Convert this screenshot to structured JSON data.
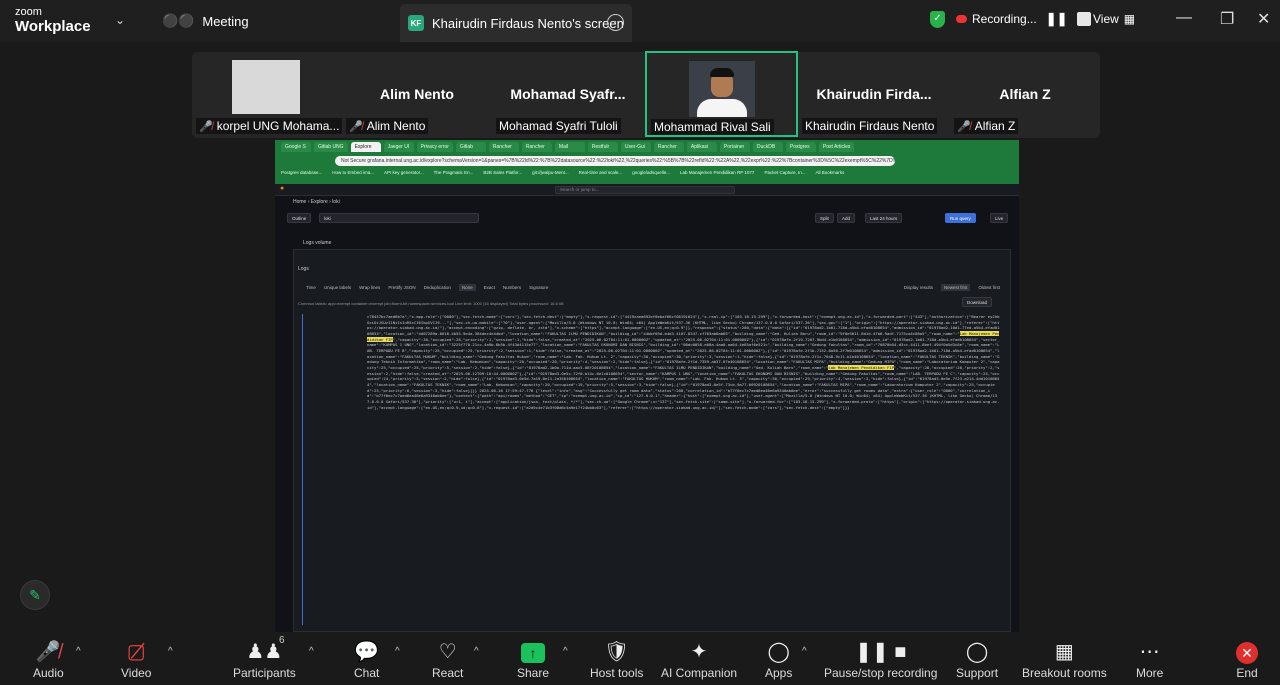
{
  "topbar": {
    "logo_line1": "zoom",
    "logo_line2": "Workplace",
    "meeting_label": "Meeting",
    "share_badge": "KF",
    "share_title": "Khairudin Firdaus Nento's screen",
    "recording_label": "Recording...",
    "view_label": "View"
  },
  "participants": [
    {
      "name": "",
      "caption": "korpel UNG Mohama..."
    },
    {
      "name": "Alim Nento",
      "caption": "Alim Nento"
    },
    {
      "name": "Mohamad  Syafr...",
      "caption": "Mohamad Syafri Tuloli"
    },
    {
      "name": "",
      "caption": "Mohammad Rival Sali"
    },
    {
      "name": "Khairudin  Firda...",
      "caption": "Khairudin Firdaus Nento"
    },
    {
      "name": "Alfian Z",
      "caption": "Alfian Z"
    }
  ],
  "shared": {
    "tabs": [
      "Google S",
      "Gitlab UNG",
      "Explore",
      "Jaeger UI",
      "Privacy error",
      "Gitlab",
      "Rancher",
      "Rancher",
      "Mail",
      "Restfulr",
      "User-Gui",
      "Rancher",
      "Aplikasi",
      "Portainer",
      "DuckDB",
      "Postgres",
      "Post Articles"
    ],
    "url": "Not Secure   grafana.internal.ung.ac.id/explore?schemaVersion=1&panes=%7B%22ld%22:%7B%22datasource%22:%22loki%22,%22queries%22:%5B%7B%22refId%22:%22A%22,%22expr%22:%22%7Bcontainer%3D%5C%22exempt%5C%22%7D%20%7C%20...",
    "bookmarks": [
      "Postgres database...",
      "How to Embed ima...",
      "API key generator...",
      "The Pragmatic En...",
      "B2B Sales Platfor...",
      "git://jwalpu-Ment...",
      "Real-time and scale...",
      "google/adsquelle...",
      "Lab Manajemen Pendidikan RP 1077",
      "Packet Capture, In...",
      "All Bookmarks"
    ],
    "app_search": "Search or jump to...",
    "breadcrumb": "Home  ›  Explore  ›  loki",
    "outline": "Outline",
    "datasource": "loki",
    "split": "Split",
    "add": "Add",
    "time_range": "Last 24 hours",
    "run_query": "Run query",
    "live": "Live",
    "logs_volume": "Logs volume",
    "logs_title": "Logs",
    "options": [
      "Time",
      "Unique labels",
      "Wrap lines",
      "Prettify JSON",
      "Deduplication",
      "None",
      "Exact",
      "Numbers",
      "Signature",
      "Display results",
      "Newest first",
      "Oldest first"
    ],
    "common_labels": "Common labels:  app=exempt  container=exempt  job=fluent-bit  namespace=services-tool    Line limit: 1000 (16 displayed)    Total bytes processed: 16.6 kB",
    "download": "Download",
    "highlight1": "Lab Manajemen Pendidikan FIP",
    "highlight2": "Lab Manajemen Pendidikan FIP",
    "log_part1": "c78457bc7aed6b?a\",\"x-app-role\":[\"0000\"],\"sec-fetch-mode\":[\"cors\"],\"sec-fetch-dest\":[\"empty\"],\"x-request-id\":[\"4419caea692ef0ebaf66cf08191624\"],\"x-real-ip\":[\"103.18.13.299\"],\"x-forwarded-host\":[\"exempt.ung.ac.id\"],\"x-forwarded-port\":[\"443\"],\"authorization\":[\"Bearer eyJhbGciOiJSUzI1NiIsInR5cCI6IkpXVCJ9...\"],\"sec-ch-ua-mobile\":[\"?0\"],\"user-agent\":[\"Mozilla/5.0 (Windows NT 10.0; Win64; x64) AppleWebKit/537.36 (KHTML, like Gecko) Chrome/137.0.0.0 Safari/537.36\"],\"sec-gpc\":[\"1\"],\"origin\":[\"https://operator.siakad.ung.ac.id\"],\"referer\":[\"https://operator.siakad.ung.ac.id/\"],\"accept-encoding\":[\"gzip, deflate, br, zstd\"],\"x-scheme\":[\"https\"],\"accept-language\":[\"en-US,en;q=0.9\"]},\"response\":{\"status\":200,\"data\":{\"data\":[{\"id\":\"01978ad2-1b01-718d-a5b4-efad0108654\",\"admission_id\":\"01978ad2-10d1-77ed-a5b4-efad0108654\",\"location_id\":\"4d07289a-6618-4b55-9e4a-384dec4e44bd\",\"location_name\":\"FAKULTAS ILMU PENDIDIKAN\",\"building_id\":\"44bbf05d-b4d3-4107-8347-cf763ab0ab65\",\"building_name\":\"Ged. Kuliah Baru\",\"room_id\":\"9f0e5611-8d1d-47b6-9adf-7175ca4c86a5\",\"room_name\":\"",
    "log_part2": "\",\"capacity\":30,\"occupied\":28,\"priority\":1,\"session\":1,\"hide\":false,\"created_at\":\"2025-06-02T04:11:01.000000Z\",\"updated_at\":\"2025-06-02T04:11:01.000000Z\"},{\"id\":\"01978afe-2f19-7207-9bd4-e1b0108654\",\"admission_id\":\"01978ad2-1b01-718d-a5b4-efad0108654\",\"sector_name\":\"KAMPUS 1 UNG\",\"location_id\":\"3225f770-21cc-4a9b-8b5b-4f43d4115e77\",\"location_name\":\"FAKULTAS EKONOMI DAN BISNIS\",\"building_id\":\"08dc0058-e68a-4aa0-aa04-4e85af6e521c\",\"building_name\":\"Gedung Fakultas\",\"room_id\":\"70870b54-d3cc-4411-8bef-494f0a5d3c8e\",\"room_name\":\"LAB. TERPADU FE B\",\"capacity\":25,\"occupied\":25,\"priority\":2,\"session\":1,\"hide\":false,\"created_at\":\"2025-06-02T04:11:01.000000Z\",\"updated_at\":\"2025-06-02T04:11:01.000000Z\"},{\"id\":\"01978afe-2f1b-7152-8a50-2f7b0108654\",\"admission_id\":\"01978ad2-1b01-718d-a5b4-efad0108654\",\"location_name\":\"FAKULTAS HUKUM\",\"building_name\":\"Gedung Fakultas Hukum\",\"room_name\":\"Lab. Fak. Hukum Lt. 2\",\"capacity\":30,\"occupied\":30,\"priority\":3,\"session\":1,\"hide\":false},{\"id\":\"01978afe-2f1c-7048-9c11-b1b40108654\",\"location_name\":\"FAKULTAS TEKNIK\",\"building_name\":\"Gedung Teknik Informatika\",\"room_name\":\"Lab. Kebumian\",\"capacity\":20,\"occupied\":20,\"priority\":4,\"session\":2,\"hide\":false},{\"id\":\"01978afe-2f1d-7359-ab37-07e40108654\",\"location_name\":\"FAKULTAS MIPA\",\"building_name\":\"Gedung MIPA\",\"room_name\":\"Laboratorium Komputer 2\",\"capacity\":25,\"occupied\":25,\"priority\":5,\"session\":2,\"hide\":false},{\"id\":\"01978ad2-1b0a-711d-aac5-08f20108654\",\"location_name\":\"FAKULTAS ILMU PENDIDIKAN\",\"building_name\":\"Ged. Kuliah Baru\",\"room_name\":\"",
    "log_part3": "\",\"capacity\":28,\"occupied\":26,\"priority\":2,\"session\":2,\"hide\":false,\"created_at\":\"2025-06-12T09:10:44.000000Z\"},{\"id\":\"01978ad3-0e5c-72f0-b14c-6e1c0108654\",\"sector_name\":\"KAMPUS 1 UNG\",\"location_name\":\"FAKULTAS EKONOMI DAN BISNIS\",\"building_name\":\"Gedung Fakultas\",\"room_name\":\"LAB. TERPADU FE C\",\"capacity\":25,\"occupied\":24,\"priority\":3,\"session\":2,\"hide\":false},{\"id\":\"01978ad3-0e5d-7a19-8e11-2a350108654\",\"location_name\":\"FAKULTAS HUKUM\",\"room_name\":\"Lab. Fak. Hukum Lt. 3\",\"capacity\":30,\"occupied\":29,\"priority\":4,\"session\":3,\"hide\":false},{\"id\":\"01978ad3-0e5e-7f23-a214-4dd10108654\",\"location_name\":\"FAKULTAS TEKNIK\",\"room_name\":\"Lab. Kebumian\",\"capacity\":20,\"occupied\":19,\"priority\":5,\"session\":3,\"hide\":false},{\"id\":\"01978ad3-0e5f-73cb-9a77-60920108654\",\"location_name\":\"FAKULTAS MIPA\",\"room_name\":\"Laboratorium Komputer 2\",\"capacity\":25,\"occupied\":25,\"priority\":6,\"session\":3,\"hide\":false}]}}    2025-06-16 17:59:47.776 {\"level\":\"info\",\"msg\":\"Successfully get room data\",\"status\":200,\"correlation_id\":\"b77f6ec7c7aed6ea46e6a9340ab0ee\",\"error\":\"successfully get rooms data\",\"extra\":{\"user_role\":\"0000\",\"correlation_id\":\"b77f6ec7c7aed6ea46e6a9340ab0ee\"},\"context\":{\"path\":\"api/rooms\",\"method\":\"GET\",\"ip\":\"exempt.ung.ac.id\",\"ip_id\":\"127.0.0.1\",\"header\":{\"host\":[\"exempt.ung.ac.id\"],\"user-agent\":[\"Mozilla/5.0 (Windows NT 10.0; Win64; x64) AppleWebKit/537.36 (KHTML, like Gecko) Chrome/137.0.0.0 Safari/537.36\"],\"priority\":[\"u=1, i\"],\"accept\":[\"application/json, text/plain, */*\"],\"sec-ch-ua\":[\"Google Chrome\";v=\"137\"],\"sec-fetch-site\":[\"same-site\"],\"x-forwarded-for\":[\"103.18.13.299\"],\"x-forwarded-proto\":[\"https\"],\"origin\":[\"https://operator.siakad.ung.ac.id\"],\"accept-language\":[\"en-US,en;q=0.9,id;q=0.8\"],\"x-request-id\":[\"a2d9c4e71b3f08d6c5a9e17f24bb0c63\"],\"referer\":[\"https://operator.siakad.ung.ac.id/\"],\"sec-fetch-mode\":[\"cors\"],\"sec-fetch-dest\":[\"empty\"]}}"
  },
  "controls": {
    "audio": "Audio",
    "video": "Video",
    "participants": "Participants",
    "participants_count": "6",
    "chat": "Chat",
    "react": "React",
    "share": "Share",
    "host_tools": "Host tools",
    "ai_companion": "AI Companion",
    "apps": "Apps",
    "pause_stop": "Pause/stop recording",
    "support": "Support",
    "breakout": "Breakout rooms",
    "more": "More",
    "end": "End"
  },
  "colors": {
    "share_green": "#1bc15c",
    "active_border": "#27c182",
    "end_red": "#e02f2f",
    "highlight": "#e8dc5a"
  }
}
